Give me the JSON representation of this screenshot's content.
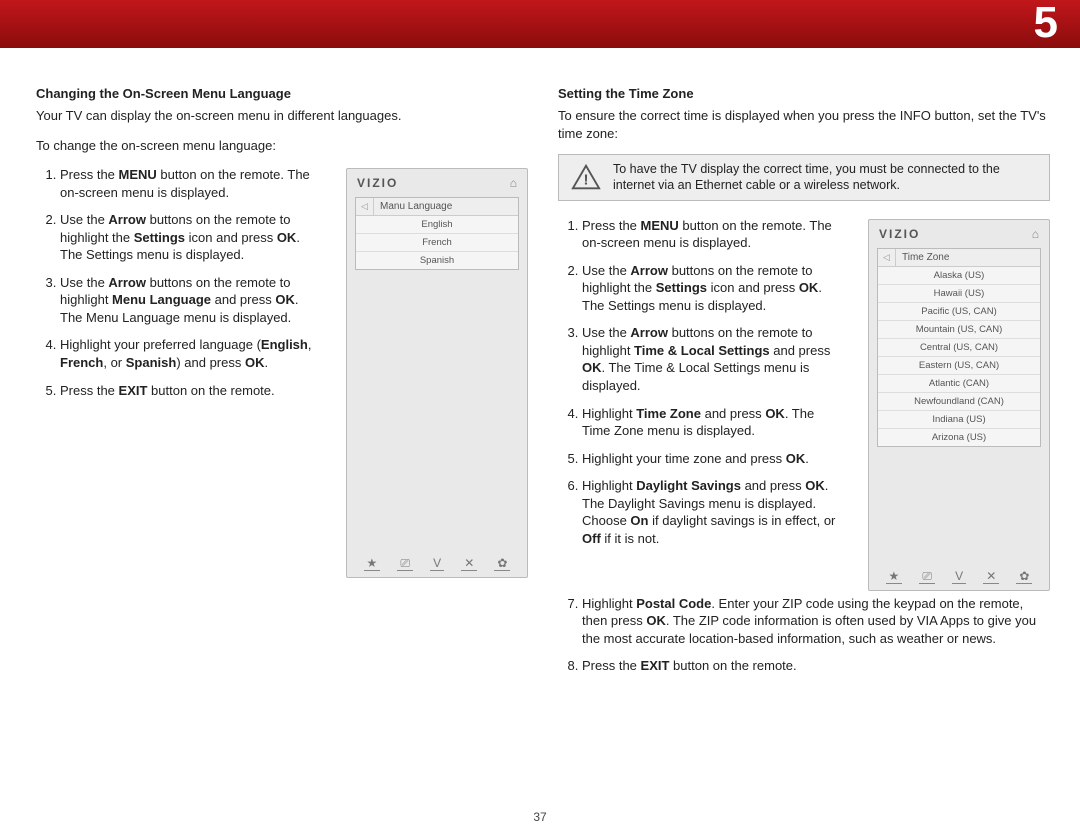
{
  "chapter_number": "5",
  "page_number": "37",
  "left": {
    "title": "Changing the On-Screen Menu Language",
    "intro1": "Your TV can display the on-screen menu in different languages.",
    "intro2": "To change the on-screen menu language:",
    "steps": [
      "Press the <b>MENU</b> button on the remote. The on-screen menu is displayed.",
      "Use the <b>Arrow</b> buttons on the remote to highlight the <b>Settings</b> icon and press <b>OK</b>. The Settings menu is displayed.",
      "Use the <b>Arrow</b> buttons on the remote to highlight <b>Menu Language</b> and press <b>OK</b>. The Menu Language menu is displayed.",
      "Highlight your preferred language (<b>English</b>, <b>French</b>, or <b>Spanish</b>) and press <b>OK</b>.",
      "Press the <b>EXIT</b> button on the remote."
    ],
    "phone": {
      "brand": "VIZIO",
      "menu_title": "Manu Language",
      "items": [
        "English",
        "French",
        "Spanish"
      ],
      "foot_icons": [
        "★",
        "⎚",
        "V",
        "✕",
        "✿"
      ]
    }
  },
  "right": {
    "title": "Setting the Time Zone",
    "intro": "To ensure the correct time is displayed when you press the INFO button, set the TV's time zone:",
    "warning": "To have the TV display the correct time, you must be connected to the internet via an Ethernet cable or a wireless network.",
    "steps": [
      "Press the <b>MENU</b> button on the remote. The on-screen menu is displayed.",
      "Use the <b>Arrow</b> buttons on the remote to highlight the <b>Settings</b> icon and press <b>OK</b>. The Settings menu is displayed.",
      "Use the <b>Arrow</b> buttons on the remote to highlight <b>Time & Local Settings</b> and press <b>OK</b>. The Time & Local Settings menu is displayed.",
      "Highlight <b>Time Zone</b> and press <b>OK</b>. The Time Zone menu is displayed.",
      "Highlight your time zone and press <b>OK</b>.",
      "Highlight <b>Daylight Savings</b> and press <b>OK</b>. The Daylight Savings menu is displayed. Choose <b>On</b> if daylight savings is in effect, or <b>Off</b> if it is not.",
      "Highlight <b>Postal Code</b>. Enter your ZIP code using the keypad on the remote, then press <b>OK</b>. The ZIP code information is often used by VIA Apps to give you the most accurate location-based information, such as weather or news.",
      "Press the <b>EXIT</b> button on the remote."
    ],
    "phone": {
      "brand": "VIZIO",
      "menu_title": "Time Zone",
      "items": [
        "Alaska (US)",
        "Hawaii (US)",
        "Pacific (US, CAN)",
        "Mountain (US, CAN)",
        "Central (US, CAN)",
        "Eastern (US, CAN)",
        "Atlantic (CAN)",
        "Newfoundland (CAN)",
        "Indiana (US)",
        "Arizona (US)"
      ],
      "foot_icons": [
        "★",
        "⎚",
        "V",
        "✕",
        "✿"
      ]
    }
  }
}
